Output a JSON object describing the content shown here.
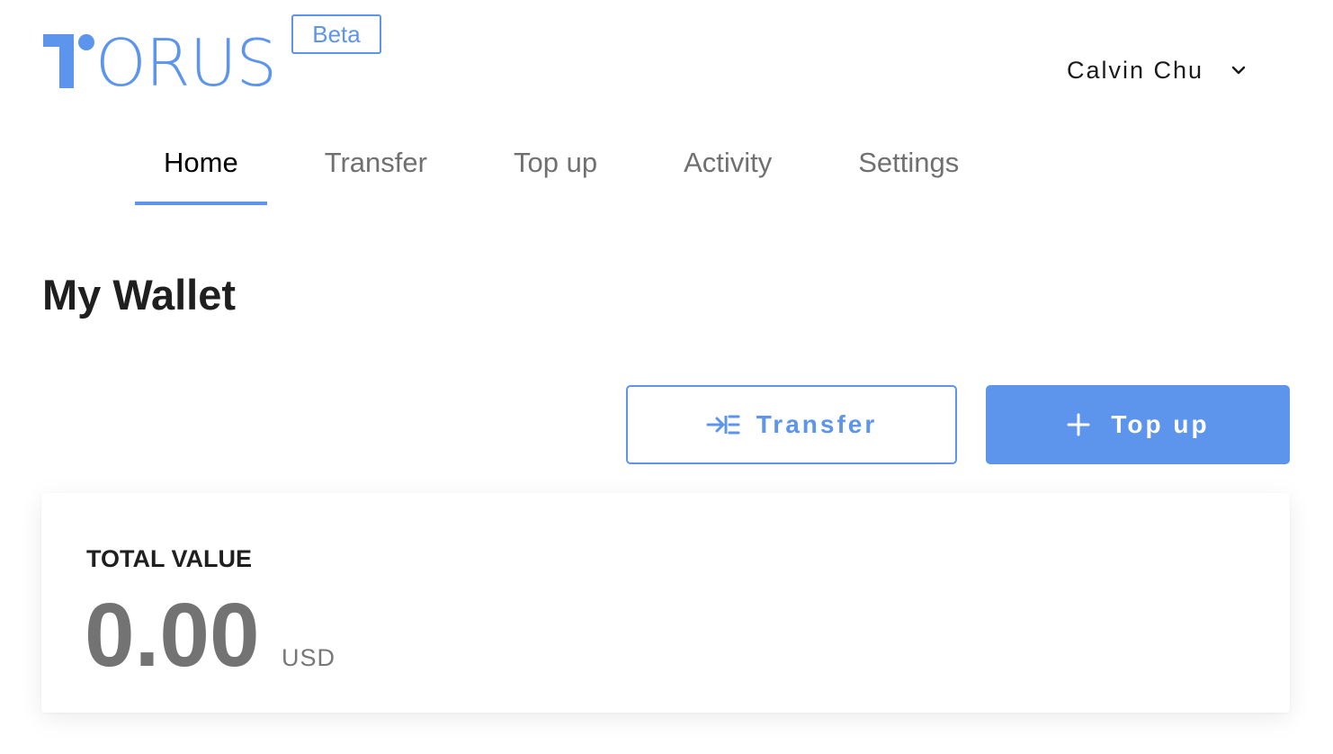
{
  "brand": {
    "logo_text": "ORUS",
    "badge": "Beta",
    "accent_color": "#5d95ec"
  },
  "user": {
    "name": "Calvin Chu",
    "menu_icon": "chevron-down-icon"
  },
  "nav": {
    "tabs": [
      {
        "label": "Home",
        "active": true
      },
      {
        "label": "Transfer",
        "active": false
      },
      {
        "label": "Top up",
        "active": false
      },
      {
        "label": "Activity",
        "active": false
      },
      {
        "label": "Settings",
        "active": false
      }
    ]
  },
  "main": {
    "title": "My Wallet",
    "actions": {
      "transfer": {
        "label": "Transfer",
        "icon": "transfer-icon"
      },
      "topup": {
        "label": "Top up",
        "icon": "plus-icon"
      }
    },
    "total": {
      "label": "TOTAL VALUE",
      "value": "0.00",
      "currency": "USD"
    }
  }
}
